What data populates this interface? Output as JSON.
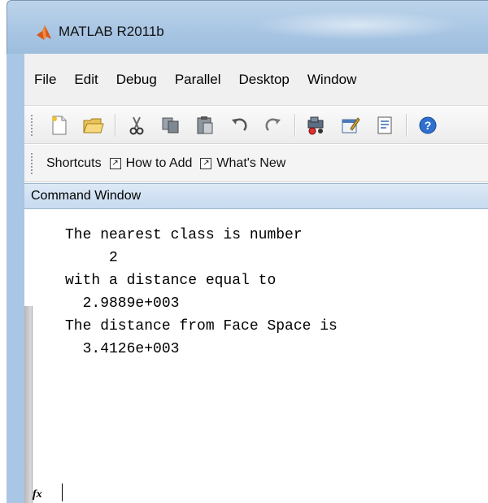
{
  "window": {
    "title": "MATLAB  R2011b",
    "icon": "matlab-logo-icon"
  },
  "menu": [
    "File",
    "Edit",
    "Debug",
    "Parallel",
    "Desktop",
    "Window"
  ],
  "toolbar": {
    "buttons": [
      "new-file-icon",
      "open-folder-icon",
      "cut-icon",
      "copy-icon",
      "paste-icon",
      "undo-icon",
      "redo-icon",
      "simulink-icon",
      "guide-icon",
      "profiler-icon",
      "help-icon"
    ]
  },
  "shortcuts": {
    "label": "Shortcuts",
    "items": [
      "How to Add",
      "What's New"
    ]
  },
  "command_window": {
    "title": "Command Window",
    "output": [
      "The nearest class is number",
      "     2",
      "",
      "with a distance equal to",
      "  2.9889e+003",
      "",
      "The distance from Face Space is",
      "  3.4126e+003"
    ],
    "fx_label": "fx"
  },
  "colors": {
    "title_bar": "#a9c6e4",
    "panel_header": "#c7daf0",
    "matlab_logo": "#d9561b"
  }
}
